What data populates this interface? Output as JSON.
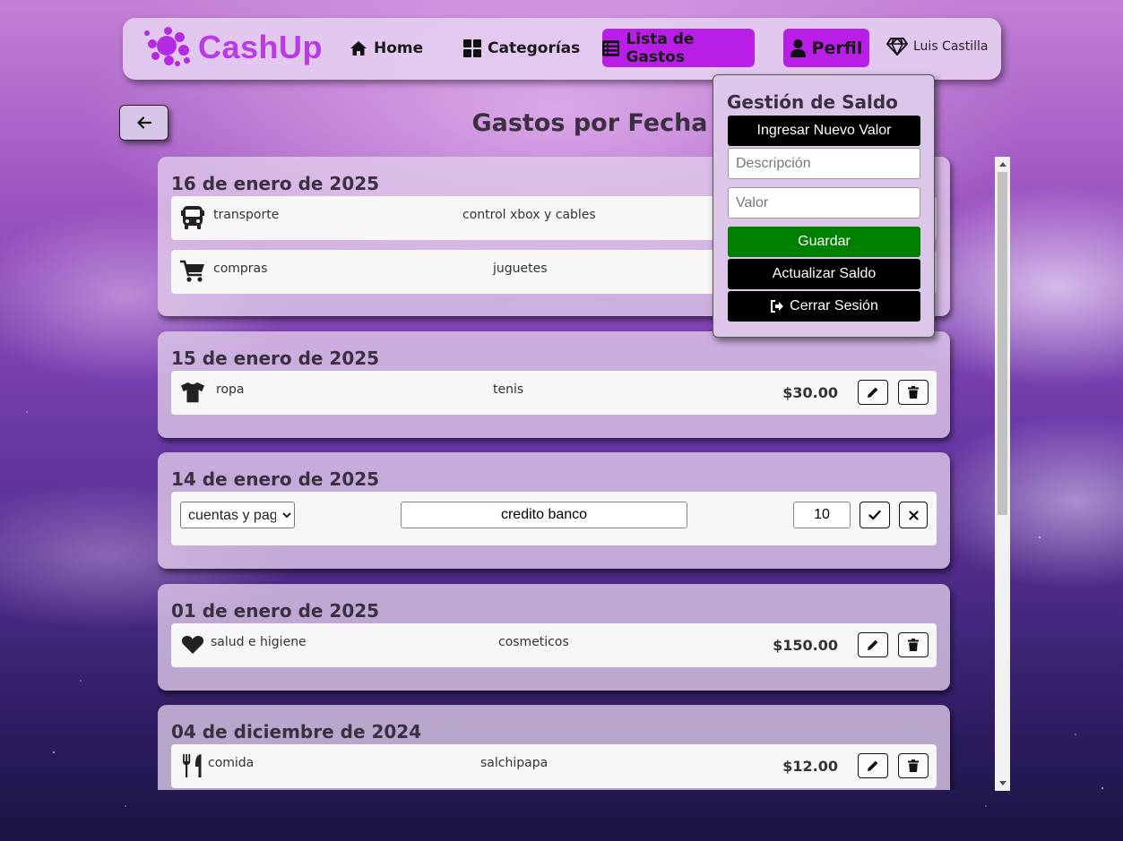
{
  "brand": {
    "name": "CashUp"
  },
  "nav": {
    "home": "Home",
    "categories": "Categorías",
    "expense_list": "Lista de Gastos",
    "profile": "Perfil",
    "user_name": "Luis Castilla"
  },
  "page": {
    "title": "Gastos por Fecha"
  },
  "days": [
    {
      "date": "16 de enero de 2025",
      "expenses": [
        {
          "category": "transporte",
          "description": "control xbox y cables",
          "icon": "bus-icon"
        },
        {
          "category": "compras",
          "description": "juguetes",
          "icon": "cart-icon"
        }
      ]
    },
    {
      "date": "15 de enero de 2025",
      "expenses": [
        {
          "category": "ropa",
          "description": "tenis",
          "amount": "$30.00",
          "icon": "shirt-icon"
        }
      ]
    },
    {
      "date": "14 de enero de 2025",
      "editing": {
        "category": "cuentas y pagos",
        "description": "credito banco",
        "value": "10"
      }
    },
    {
      "date": "01 de enero de 2025",
      "expenses": [
        {
          "category": "salud e higiene",
          "description": "cosmeticos",
          "amount": "$150.00",
          "icon": "heart-icon"
        }
      ]
    },
    {
      "date": "04 de diciembre de 2024",
      "expenses": [
        {
          "category": "comida",
          "description": "salchipapa",
          "amount": "$12.00",
          "icon": "utensils-icon"
        }
      ]
    }
  ],
  "saldo_panel": {
    "title": "Gestión de Saldo",
    "new_value_button": "Ingresar Nuevo Valor",
    "description_placeholder": "Descripción",
    "value_placeholder": "Valor",
    "save_button": "Guardar",
    "update_button": "Actualizar Saldo",
    "logout_button": "Cerrar Sesión"
  },
  "colors": {
    "accent": "#b81ee6",
    "brand_text": "#b83be6",
    "save_green": "#008000"
  }
}
